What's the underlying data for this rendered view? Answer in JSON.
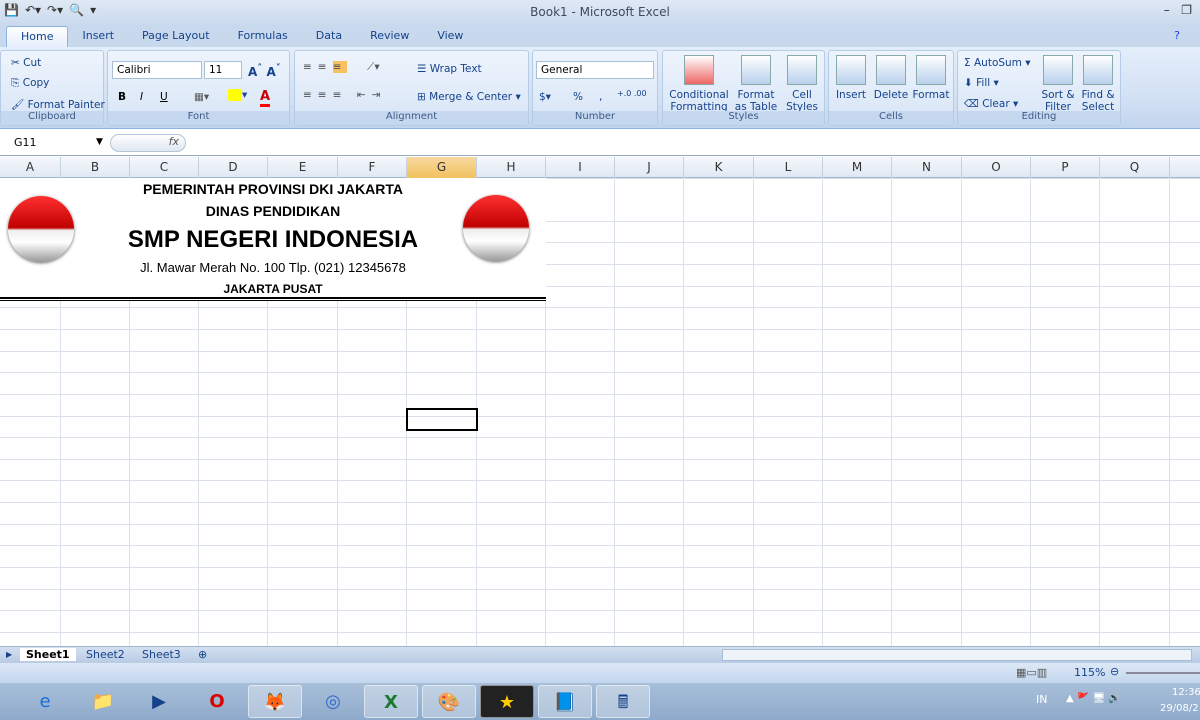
{
  "window": {
    "title": "Book1 - Microsoft Excel"
  },
  "tabs": [
    "Home",
    "Insert",
    "Page Layout",
    "Formulas",
    "Data",
    "Review",
    "View"
  ],
  "clipboard": {
    "cut": "Cut",
    "copy": "Copy",
    "format_painter": "Format Painter",
    "label": "Clipboard"
  },
  "font": {
    "name": "Calibri",
    "size": "11",
    "label": "Font",
    "bold": "B",
    "italic": "I",
    "underline": "U"
  },
  "alignment": {
    "wrap": "Wrap Text",
    "merge": "Merge & Center",
    "label": "Alignment"
  },
  "number": {
    "format": "General",
    "percent": "%",
    "comma": ",",
    "label": "Number"
  },
  "styles": {
    "conditional": "Conditional Formatting",
    "format_table": "Format as Table",
    "cell_styles": "Cell Styles",
    "label": "Styles"
  },
  "cells": {
    "insert": "Insert",
    "delete": "Delete",
    "format": "Format",
    "label": "Cells"
  },
  "editing": {
    "autosum": "AutoSum",
    "fill": "Fill",
    "clear": "Clear",
    "sort": "Sort & Filter",
    "find": "Find & Select",
    "label": "Editing"
  },
  "formula_bar": {
    "name_box": "G11",
    "fx": "fx",
    "value": ""
  },
  "columns": [
    "A",
    "B",
    "C",
    "D",
    "E",
    "F",
    "G",
    "H",
    "I",
    "J",
    "K",
    "L",
    "M",
    "N",
    "O",
    "P",
    "Q"
  ],
  "selected_column": "G",
  "sheet": {
    "line1": "PEMERINTAH PROVINSI DKI JAKARTA",
    "line2": "DINAS PENDIDIKAN",
    "line3": "SMP NEGERI INDONESIA",
    "line4": "Jl. Mawar Merah No. 100 Tlp. (021) 12345678",
    "line5": "JAKARTA PUSAT"
  },
  "sheet_tabs": [
    "Sheet1",
    "Sheet2",
    "Sheet3"
  ],
  "active_sheet": "Sheet1",
  "status": {
    "zoom": "115%"
  },
  "taskbar": {
    "lang": "IN",
    "time": "12:36",
    "date": "29/08/2"
  }
}
